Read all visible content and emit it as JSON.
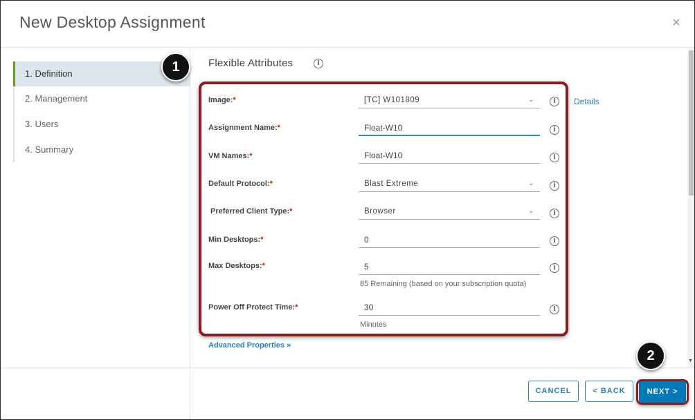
{
  "dialog": {
    "title": "New Desktop Assignment",
    "close_glyph": "×"
  },
  "nav": {
    "items": [
      {
        "label": "1. Definition",
        "active": true
      },
      {
        "label": "2. Management",
        "active": false
      },
      {
        "label": "3. Users",
        "active": false
      },
      {
        "label": "4. Summary",
        "active": false
      }
    ]
  },
  "callouts": {
    "one": "1",
    "two": "2"
  },
  "section": {
    "title": "Flexible Attributes",
    "info_glyph": "i"
  },
  "form": {
    "required_mark": "*",
    "image": {
      "label": "Image:",
      "value": "[TC] W101809"
    },
    "details_link": "Details",
    "assignment_name": {
      "label": "Assignment Name:",
      "value": "Float-W10"
    },
    "vm_names": {
      "label": "VM Names:",
      "value": "Float-W10"
    },
    "default_protocol": {
      "label": "Default Protocol:",
      "value": "Blast Extreme"
    },
    "preferred_client_type": {
      "label": "Preferred Client Type:",
      "value": "Browser"
    },
    "min_desktops": {
      "label": "Min Desktops:",
      "value": "0"
    },
    "max_desktops": {
      "label": "Max Desktops:",
      "value": "5",
      "hint": "85 Remaining (based on your subscription quota)"
    },
    "power_off_protect_time": {
      "label": "Power Off Protect Time:",
      "value": "30",
      "hint": "Minutes"
    }
  },
  "advanced": {
    "label": "Advanced Properties »"
  },
  "footer": {
    "cancel": "CANCEL",
    "back": "< BACK",
    "next": "NEXT >"
  },
  "colors": {
    "accent": "#0079b8",
    "link": "#2b7ec0",
    "active_bar": "#62a420",
    "callout_border": "#8c1a1f",
    "required": "#c21d00"
  },
  "icons": {
    "close": "close-icon",
    "info": "info-icon",
    "dropdown": "chevron-down-icon"
  }
}
